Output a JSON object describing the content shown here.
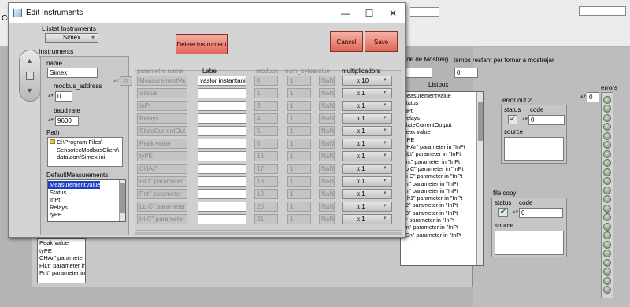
{
  "background": {
    "title_fragment": "Co",
    "periode_label": "iode de Mostreig",
    "periode_value": "5",
    "temps_label": "temps restant per tornar a mostrejar",
    "temps_value": "0",
    "listbox_label": "Listbox",
    "listbox_items": [
      "MeasurementValue",
      "Status",
      "InPt",
      "Relays",
      "StateCurrentOutput",
      "Peak value",
      "tyPE",
      "CHAr\" parameter in \"InPt",
      "FiLt\" parameter in \"InPt",
      "Pnt\" parameter in \"InPt",
      "Lo C\" parameter in \"InPt",
      "Hi C\" parameter in \"InPt",
      "o r\" parameter in \"InPt",
      "d r\" parameter in \"InPt",
      "o h1\" parameter in \"InPt",
      "h2\" parameter in \"InPt",
      "h3\" parameter in \"InPt",
      "d\" parameter in \"InPt",
      "Sn\" parameter in \"InPt",
      "t Sh\" parameter in \"InPt"
    ],
    "error_out2": {
      "title": "error out 2",
      "status_label": "status",
      "code_label": "code",
      "code_value": "0",
      "source_label": "source"
    },
    "file_copy": {
      "title": "file copy",
      "status_label": "status",
      "code_label": "code",
      "code_value": "0",
      "source_label": "source"
    },
    "errors": {
      "label": "errors",
      "index": "0"
    },
    "left_list_items": [
      "Peak value",
      "tyPE",
      "CHAr\" parameter i",
      "FiLt\" parameter in",
      "Pnt\" parameter in"
    ]
  },
  "dialog": {
    "title": "Edit Instruments",
    "controls": {
      "minimize": "—",
      "maximize": "☐",
      "close": "✕"
    },
    "llistat_label": "Llistat Instruments",
    "llistat_value": "Simex",
    "delete_button": "Delete Instrument",
    "cancel_button": "Cancel",
    "save_button": "Save",
    "instruments_label": "Instruments",
    "name_label": "name",
    "name_value": "Simex",
    "modbus_label": "modbus_address",
    "modbus_value": "0",
    "baud_label": "baud rate",
    "baud_value": "9600",
    "path_label": "Path",
    "path_lines": [
      "C:\\Program Files\\",
      "SensotecModbusClient\\",
      "data\\confSimex.ini"
    ],
    "defmeas_label": "DefaultMeasurements",
    "defmeas_items": [
      "MeasurementValue",
      "Status",
      "InPt",
      "Relays",
      "tyPE"
    ],
    "table_index": "0",
    "columns": {
      "param": "parametre name",
      "label": "Label",
      "modbus": "modbus",
      "num_bytes": "num_bytes",
      "value": "value",
      "mult": "multiplicadors"
    },
    "rows": [
      {
        "param": "MeasurementVa",
        "label": "vaslor instantani",
        "modbus": "0",
        "num_bytes": "1",
        "value": "NaN",
        "mult": "x 10"
      },
      {
        "param": "Status",
        "label": "",
        "modbus": "1",
        "num_bytes": "1",
        "value": "NaN",
        "mult": "x 1"
      },
      {
        "param": "InPt",
        "label": "",
        "modbus": "3",
        "num_bytes": "1",
        "value": "NaN",
        "mult": "x 1"
      },
      {
        "param": "Relays",
        "label": "",
        "modbus": "4",
        "num_bytes": "1",
        "value": "NaN",
        "mult": "x 1"
      },
      {
        "param": "StateCurrentOut",
        "label": "",
        "modbus": "5",
        "num_bytes": "1",
        "value": "NaN",
        "mult": "x 1"
      },
      {
        "param": "Peak value",
        "label": "",
        "modbus": "5",
        "num_bytes": "1",
        "value": "NaN",
        "mult": "x 1"
      },
      {
        "param": "tyPE",
        "label": "",
        "modbus": "16",
        "num_bytes": "1",
        "value": "NaN",
        "mult": "x 1"
      },
      {
        "param": "CHAr\"",
        "label": "",
        "modbus": "17",
        "num_bytes": "1",
        "value": "NaN",
        "mult": "x 1"
      },
      {
        "param": "FiLt\" parameter",
        "label": "",
        "modbus": "18",
        "num_bytes": "1",
        "value": "NaN",
        "mult": "x 1"
      },
      {
        "param": "Pnt\" parameter",
        "label": "",
        "modbus": "19",
        "num_bytes": "1",
        "value": "NaN",
        "mult": "x 1"
      },
      {
        "param": "Lo C\" parameter",
        "label": "",
        "modbus": "20",
        "num_bytes": "1",
        "value": "NaN",
        "mult": "x 1"
      },
      {
        "param": "Hi C\" parameter",
        "label": "",
        "modbus": "21",
        "num_bytes": "1",
        "value": "NaN",
        "mult": "x 1"
      }
    ]
  }
}
